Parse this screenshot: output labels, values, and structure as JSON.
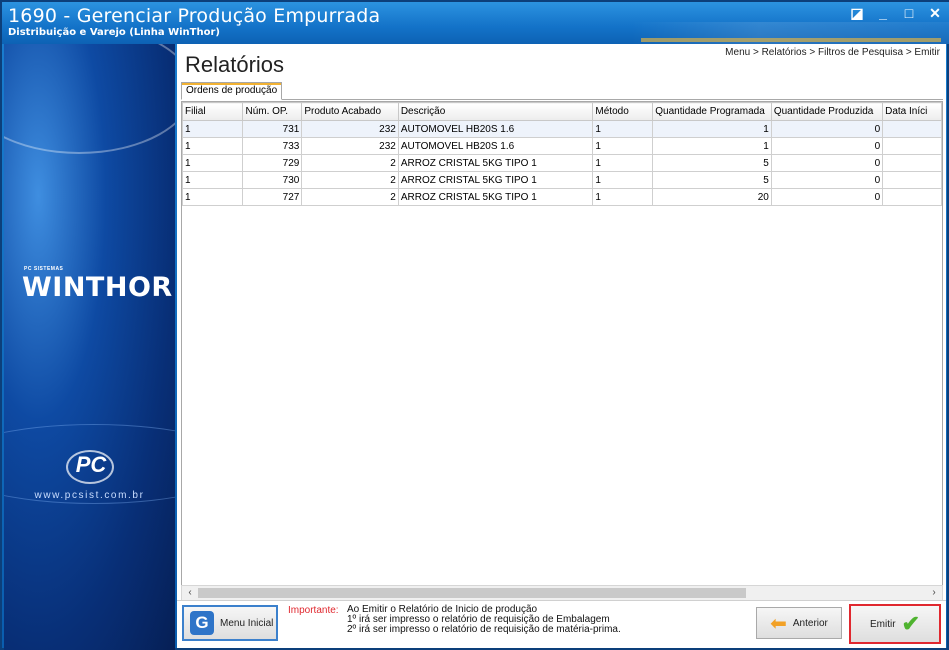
{
  "window": {
    "title": "1690 - Gerenciar Produção Empurrada",
    "subtitle": "Distribuição e Varejo (Linha WinThor)",
    "controls": [
      "◪",
      "_",
      "□",
      "✕"
    ]
  },
  "brand": {
    "small": "PC SISTEMAS",
    "logo": "WINTHOR",
    "pc": "PC",
    "site": "www.pcsist.com.br"
  },
  "page": {
    "heading": "Relatórios",
    "breadcrumb": "Menu > Relatórios > Filtros de Pesquisa > Emitir"
  },
  "tabs": [
    {
      "label": "Ordens de produção"
    }
  ],
  "grid": {
    "columns": [
      "Filial",
      "Núm. OP.",
      "Produto Acabado",
      "Descrição",
      "Método",
      "Quantidade Programada",
      "Quantidade Produzida",
      "Data Iníci"
    ],
    "rows": [
      [
        "1",
        "731",
        "232",
        "AUTOMOVEL HB20S 1.6",
        "1",
        "1",
        "0",
        ""
      ],
      [
        "1",
        "733",
        "232",
        "AUTOMOVEL HB20S 1.6",
        "1",
        "1",
        "0",
        ""
      ],
      [
        "1",
        "729",
        "2",
        "ARROZ CRISTAL 5KG TIPO 1",
        "1",
        "5",
        "0",
        ""
      ],
      [
        "1",
        "730",
        "2",
        "ARROZ CRISTAL 5KG TIPO 1",
        "1",
        "5",
        "0",
        ""
      ],
      [
        "1",
        "727",
        "2",
        "ARROZ CRISTAL 5KG TIPO 1",
        "1",
        "20",
        "0",
        ""
      ]
    ]
  },
  "footer": {
    "menu_label": "Menu Inicial",
    "notice_label": "Importante:",
    "notice_lines": [
      "Ao Emitir o Relatório de Inicio de produção",
      "1º irá ser impresso o relatório de requisição de Embalagem",
      "2º irá ser impresso o relatório de requisição de matéria-prima."
    ],
    "prev_label": "Anterior",
    "emit_label": "Emitir"
  },
  "icons": {
    "menu": "g-logo-icon",
    "prev": "arrow-left-icon",
    "emit": "checkmark-icon"
  }
}
